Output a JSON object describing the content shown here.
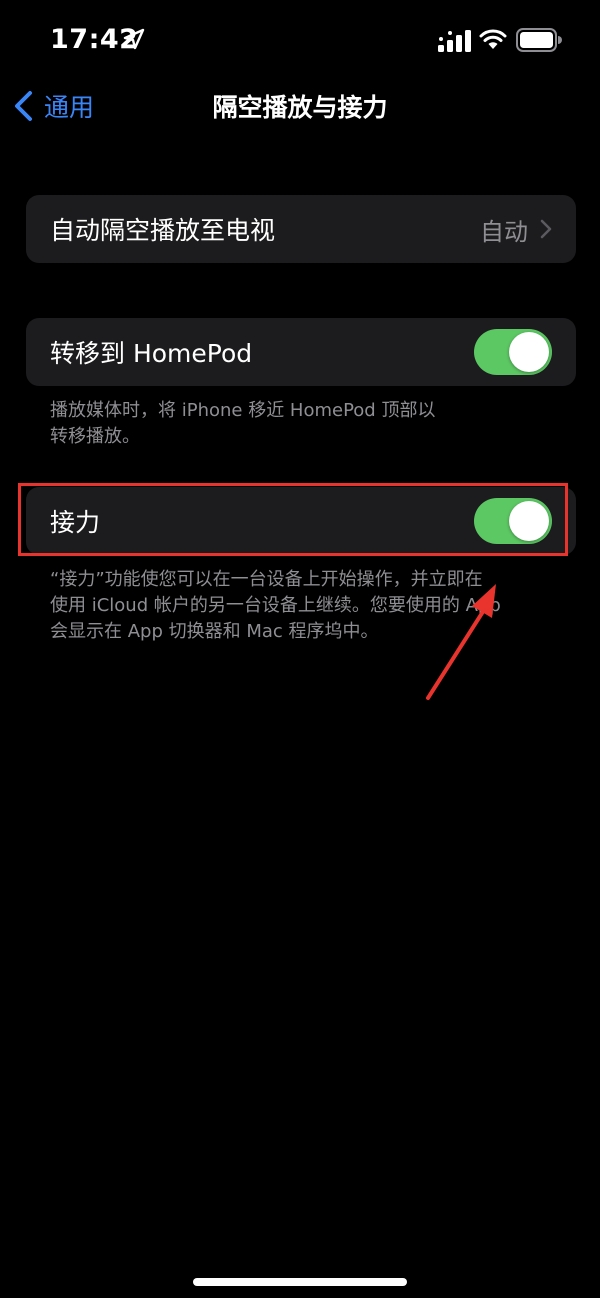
{
  "status_bar": {
    "time": "17:42",
    "icons": [
      "location-arrow-icon",
      "cellular-signal-icon",
      "wifi-icon",
      "battery-icon"
    ]
  },
  "nav": {
    "back_label": "通用",
    "title": "隔空播放与接力"
  },
  "airplay": {
    "label": "自动隔空播放至电视",
    "value": "自动"
  },
  "homepod": {
    "label": "转移到 HomePod",
    "toggle_on": true,
    "footnote_line1": "播放媒体时，将 iPhone 移近 HomePod 顶部以",
    "footnote_line2": "转移播放。"
  },
  "handoff": {
    "label": "接力",
    "toggle_on": true,
    "footnote_line1": "“接力”功能使您可以在一台设备上开始操作，并立即在",
    "footnote_line2": "使用 iCloud 帐户的另一台设备上继续。您要使用的 App",
    "footnote_line3": "会显示在 App 切换器和 Mac 程序坞中。"
  },
  "colors": {
    "accent": "#3b86f7",
    "toggle_on": "#5cc863",
    "cell_bg": "#1c1c1e",
    "secondary_text": "#8e8e93",
    "annotation": "#e8342d"
  }
}
